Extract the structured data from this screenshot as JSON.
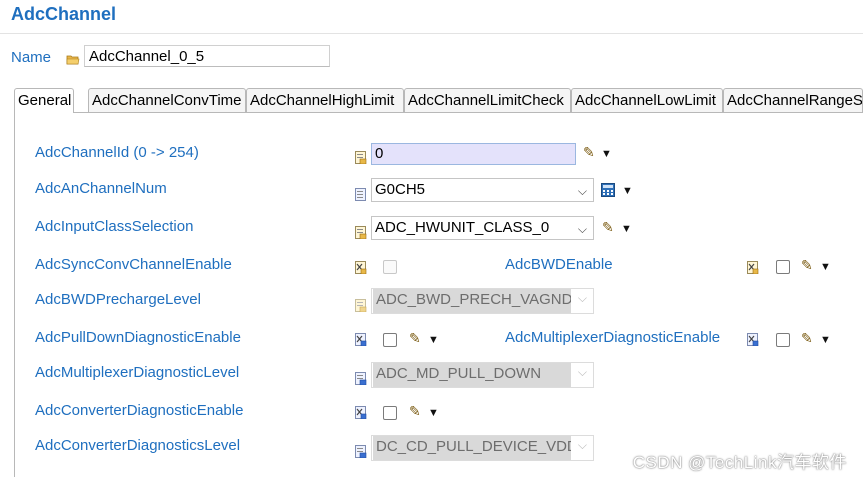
{
  "header": {
    "title": "AdcChannel"
  },
  "name_field": {
    "label": "Name",
    "value": "AdcChannel_0_5"
  },
  "tabs": [
    {
      "label": "General",
      "active": true
    },
    {
      "label": "AdcChannelConvTime",
      "active": false
    },
    {
      "label": "AdcChannelHighLimit",
      "active": false
    },
    {
      "label": "AdcChannelLimitCheck",
      "active": false
    },
    {
      "label": "AdcChannelLowLimit",
      "active": false
    },
    {
      "label": "AdcChannelRangeS",
      "active": false
    }
  ],
  "fields": {
    "channel_id": {
      "label": "AdcChannelId (0 -> 254)",
      "value": "0"
    },
    "an_channel_num": {
      "label": "AdcAnChannelNum",
      "value": "G0CH5"
    },
    "input_class": {
      "label": "AdcInputClassSelection",
      "value": "ADC_HWUNIT_CLASS_0"
    },
    "sync_conv": {
      "label": "AdcSyncConvChannelEnable"
    },
    "bwd_enable": {
      "label": "AdcBWDEnable"
    },
    "bwd_precharge": {
      "label": "AdcBWDPrechargeLevel",
      "value": "ADC_BWD_PRECH_VAGND"
    },
    "pulldown_diag": {
      "label": "AdcPullDownDiagnosticEnable"
    },
    "mux_diag_enable": {
      "label": "AdcMultiplexerDiagnosticEnable"
    },
    "mux_diag_level": {
      "label": "AdcMultiplexerDiagnosticLevel",
      "value": "ADC_MD_PULL_DOWN"
    },
    "conv_diag_enable": {
      "label": "AdcConverterDiagnosticEnable"
    },
    "conv_diag_level": {
      "label": "AdcConverterDiagnosticsLevel",
      "value": "DC_CD_PULL_DEVICE_VDDM"
    }
  },
  "watermark": "CSDN @TechLink汽车软件",
  "icons": {
    "name": "folder-icon",
    "field": "config-param-icon",
    "edit": "pencil-icon",
    "menu": "dropdown-arrow-icon",
    "calc": "calculator-icon"
  }
}
